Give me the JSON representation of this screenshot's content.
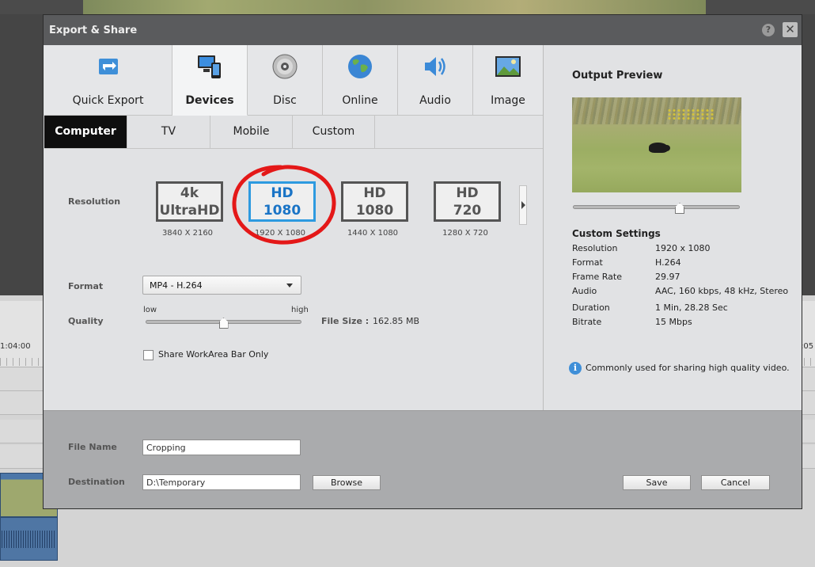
{
  "dialog": {
    "title": "Export & Share",
    "help_label": "?",
    "close_label": "✕"
  },
  "main_tabs": [
    {
      "label": "Quick Export",
      "icon": "quick-export-icon"
    },
    {
      "label": "Devices",
      "icon": "devices-icon",
      "active": true
    },
    {
      "label": "Disc",
      "icon": "disc-icon"
    },
    {
      "label": "Online",
      "icon": "globe-icon"
    },
    {
      "label": "Audio",
      "icon": "speaker-icon"
    },
    {
      "label": "Image",
      "icon": "image-icon"
    }
  ],
  "sub_tabs": [
    {
      "label": "Computer",
      "active": true
    },
    {
      "label": "TV"
    },
    {
      "label": "Mobile"
    },
    {
      "label": "Custom"
    }
  ],
  "resolution": {
    "label": "Resolution",
    "options": [
      {
        "line1": "4k",
        "line2": "UltraHD",
        "dims": "3840 X 2160"
      },
      {
        "line1": "HD",
        "line2": "1080",
        "dims": "1920 X 1080",
        "selected": true
      },
      {
        "line1": "HD",
        "line2": "1080",
        "dims": "1440 X 1080"
      },
      {
        "line1": "HD",
        "line2": "720",
        "dims": "1280 X 720"
      }
    ]
  },
  "format": {
    "label": "Format",
    "value": "MP4 - H.264"
  },
  "quality": {
    "label": "Quality",
    "low": "low",
    "high": "high",
    "level": 0.5
  },
  "file_size": {
    "label": "File Size :",
    "value": "162.85 MB"
  },
  "share_workarea": {
    "label": "Share WorkArea Bar Only",
    "checked": false
  },
  "preview": {
    "title": "Output Preview",
    "scrub_position": 0.64
  },
  "custom_settings": {
    "title": "Custom Settings",
    "rows": [
      {
        "key": "Resolution",
        "value": "1920 x 1080"
      },
      {
        "key": "Format",
        "value": "H.264"
      },
      {
        "key": "Frame Rate",
        "value": "29.97"
      },
      {
        "key": "Audio",
        "value": "AAC, 160 kbps, 48 kHz, Stereo"
      },
      {
        "key": "Duration",
        "value": "1 Min, 28.28 Sec"
      },
      {
        "key": "Bitrate",
        "value": "15 Mbps"
      }
    ]
  },
  "info": {
    "text": "Commonly used for sharing high quality video."
  },
  "file_name": {
    "label": "File Name",
    "value": "Cropping"
  },
  "destination": {
    "label": "Destination",
    "value": "D:\\Temporary",
    "browse_label": "Browse"
  },
  "actions": {
    "save_label": "Save",
    "cancel_label": "Cancel"
  },
  "timeline": {
    "time_left": "1:04:00",
    "time_right": ":05"
  },
  "colors": {
    "selected_border": "#2d9ae0",
    "selected_text": "#1a74c6",
    "annotation": "#e41818",
    "active_subtab": "#0e0e0e"
  }
}
